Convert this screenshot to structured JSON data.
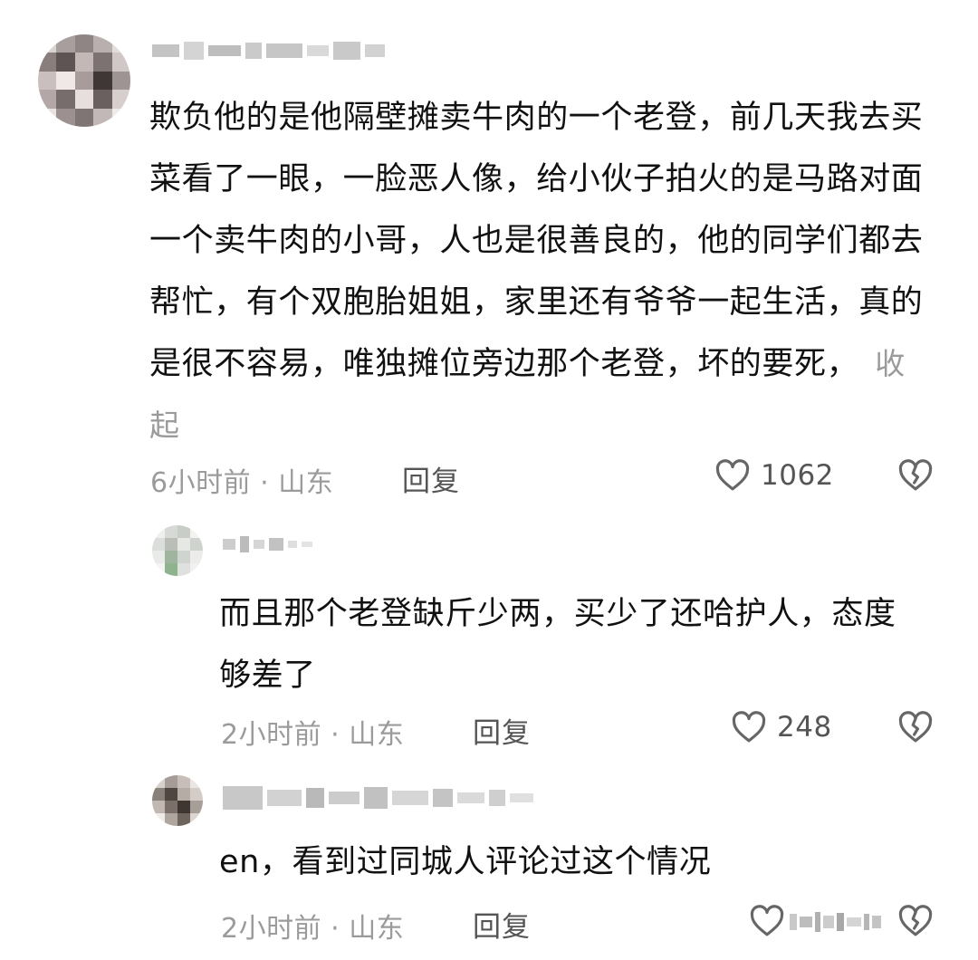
{
  "colors": {
    "text_primary": "#111111",
    "text_meta": "#9b9b9b",
    "text_secondary": "#555555",
    "background": "#ffffff",
    "icon_stroke": "#666666"
  },
  "comments": [
    {
      "text": "欺负他的是他隔壁摊卖牛肉的一个老登，前几天我去买菜看了一眼，一脸恶人像，给小伙子拍火的是马路对面一个卖牛肉的小哥，人也是很善良的，他的同学们都去帮忙，有个双胞胎姐姐，家里还有爷爷一起生活，真的是很不容易，唯独摊位旁边那个老登，坏的要死，",
      "collapse_label": "收起",
      "meta": "6小时前 · 山东",
      "reply_label": "回复",
      "likes": "1062",
      "like_icon": "heart-icon",
      "dislike_icon": "broken-heart-icon"
    },
    {
      "text": "而且那个老登缺斤少两，买少了还哈护人，态度够差了",
      "meta": "2小时前 · 山东",
      "reply_label": "回复",
      "likes": "248",
      "like_icon": "heart-icon",
      "dislike_icon": "broken-heart-icon"
    },
    {
      "text": "en，看到过同城人评论过这个情况",
      "meta": "2小时前 · 山东",
      "reply_label": "回复",
      "like_icon": "heart-icon",
      "dislike_icon": "broken-heart-icon"
    }
  ]
}
